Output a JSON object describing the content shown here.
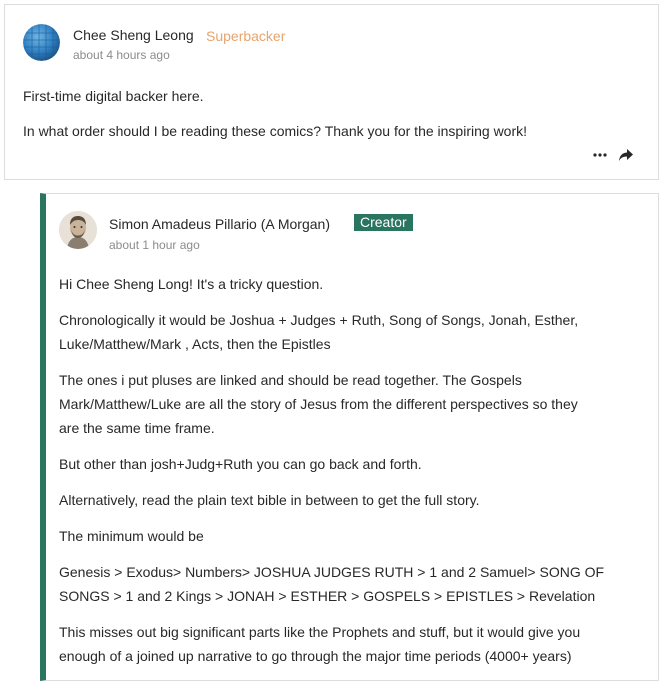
{
  "comment": {
    "author": "Chee Sheng Leong",
    "badge": "Superbacker",
    "time": "about 4 hours ago",
    "paragraphs": [
      "First-time digital backer here.",
      "In what order should I be reading these comics? Thank you for the inspiring work!"
    ],
    "actions": {
      "more_icon": "more-horizontal-icon",
      "share_icon": "share-arrow-icon"
    }
  },
  "reply": {
    "author": "Simon Amadeus Pillario (A Morgan)",
    "badge": "Creator",
    "time": "about 1 hour ago",
    "lines": [
      "Hi Chee Sheng Long! It's a tricky question.",
      "Chronologically it would be Joshua + Judges + Ruth, Song of Songs, Jonah, Esther,",
      "Luke/Matthew/Mark , Acts, then the Epistles",
      "The ones i put pluses are linked and should be read together. The Gospels",
      "Mark/Matthew/Luke are all the story of Jesus from the different perspectives so they",
      "are the same time frame.",
      "But other than josh+Judg+Ruth you can go back and forth.",
      "Alternatively, read the plain text bible in between to get the full story.",
      "The minimum would be",
      "Genesis > Exodus> Numbers> JOSHUA JUDGES RUTH > 1 and 2 Samuel> SONG OF",
      "SONGS > 1 and 2 Kings > JONAH > ESTHER > GOSPELS > EPISTLES > Revelation",
      "This misses out big significant parts like the Prophets and stuff, but it would give you",
      "enough of a joined up narrative to go through the major time periods (4000+ years)"
    ]
  },
  "colors": {
    "creator_accent": "#2a7560",
    "superbacker": "#e9a46b",
    "text": "#282828",
    "muted": "#8b8c8c",
    "border": "#dcdedd"
  }
}
